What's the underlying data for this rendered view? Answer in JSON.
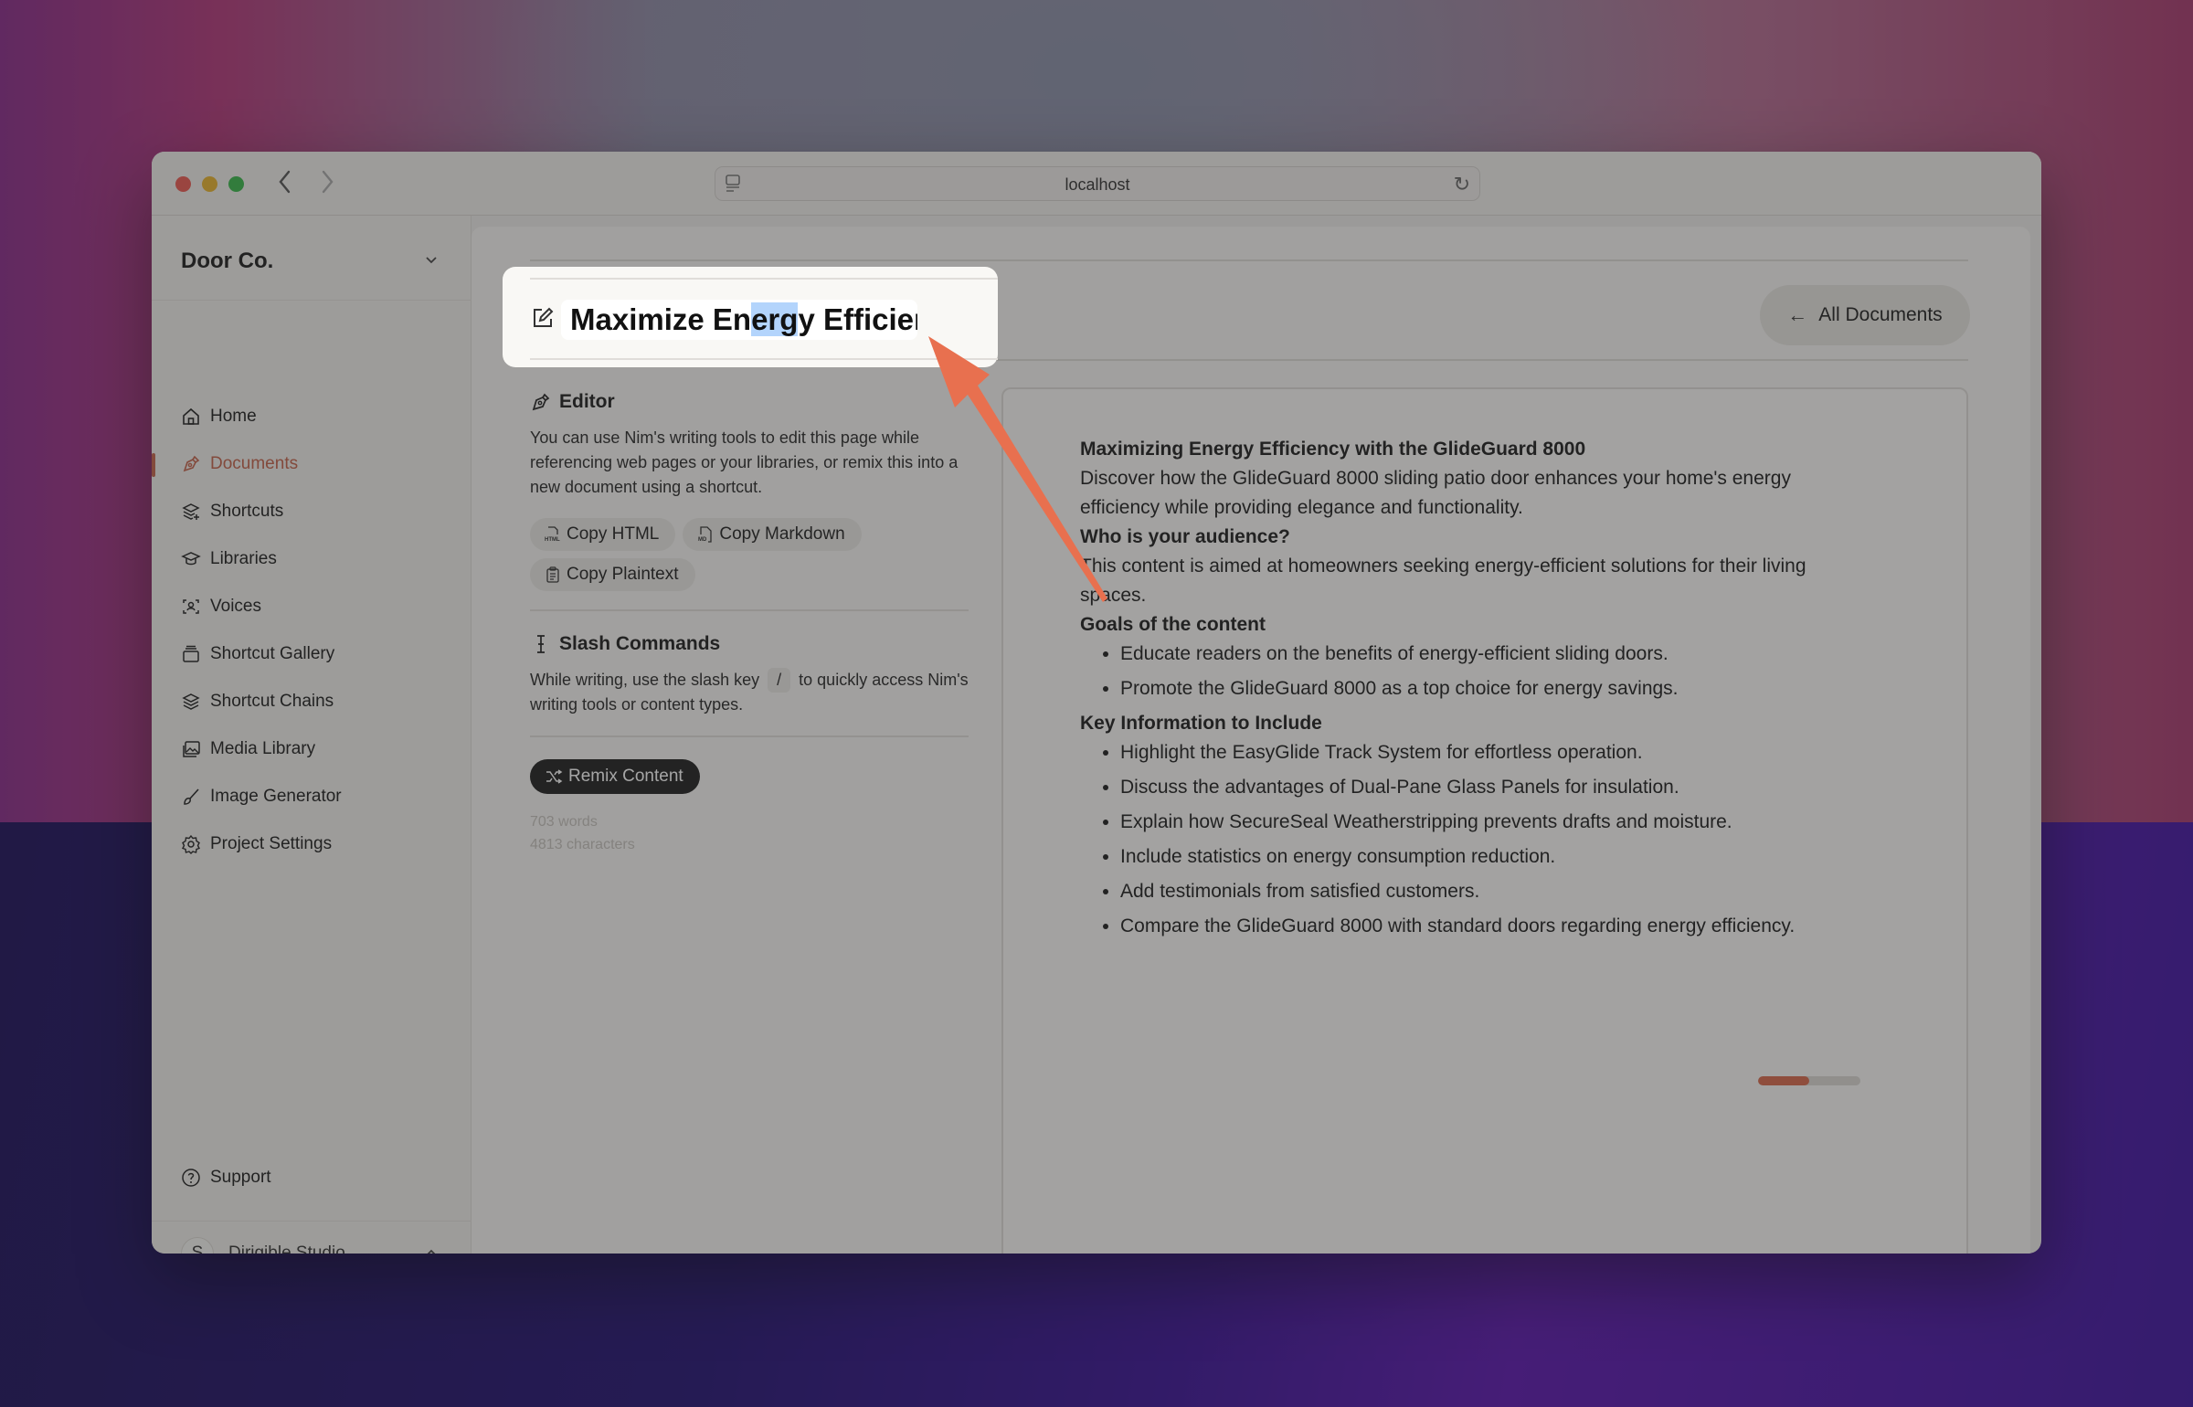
{
  "browser": {
    "url": "localhost",
    "back_icon": "chevron-left-icon",
    "forward_icon": "chevron-right-icon",
    "reload_icon": "reload-icon"
  },
  "sidebar": {
    "org_name": "Door Co.",
    "items": [
      {
        "label": "Home",
        "icon": "home-icon"
      },
      {
        "label": "Documents",
        "icon": "pen-icon",
        "active": true
      },
      {
        "label": "Shortcuts",
        "icon": "layers-plus-icon"
      },
      {
        "label": "Libraries",
        "icon": "graduation-cap-icon"
      },
      {
        "label": "Voices",
        "icon": "voice-scan-icon"
      },
      {
        "label": "Shortcut Gallery",
        "icon": "gallery-icon"
      },
      {
        "label": "Shortcut Chains",
        "icon": "stack-icon"
      },
      {
        "label": "Media Library",
        "icon": "image-icon"
      },
      {
        "label": "Image Generator",
        "icon": "brush-icon"
      },
      {
        "label": "Project Settings",
        "icon": "gear-icon"
      }
    ],
    "support_label": "Support",
    "account": {
      "initial": "S",
      "name": "Dirigible Studio"
    }
  },
  "header": {
    "title_visible": "Maximize Energy Efficienc",
    "title_before_selection": "Maximize En",
    "title_selection": "erg",
    "title_after_selection": "y Efficienc",
    "back_label": "All Documents"
  },
  "editor": {
    "heading": "Editor",
    "description": "You can use Nim's writing tools to edit this page while referencing web pages or your libraries, or remix this into a new document using a shortcut.",
    "copy_buttons": [
      {
        "label": "Copy HTML",
        "icon": "html-file-icon"
      },
      {
        "label": "Copy Markdown",
        "icon": "markdown-file-icon"
      },
      {
        "label": "Copy Plaintext",
        "icon": "clipboard-icon"
      }
    ],
    "slash_heading": "Slash Commands",
    "slash_text_before": "While writing, use the slash key",
    "slash_key": "/",
    "slash_text_after": "to quickly access Nim's writing tools or content types.",
    "remix_label": "Remix Content",
    "word_count": "703 words",
    "char_count": "4813 characters"
  },
  "document": {
    "title": "Maximizing Energy Efficiency with the GlideGuard 8000",
    "intro": "Discover how the GlideGuard 8000 sliding patio door enhances your home's energy efficiency while providing elegance and functionality.",
    "audience_heading": "Who is your audience?",
    "audience_text": "This content is aimed at homeowners seeking energy-efficient solutions for their living spaces.",
    "goals_heading": "Goals of the content",
    "goals": [
      "Educate readers on the benefits of energy-efficient sliding doors.",
      "Promote the GlideGuard 8000 as a top choice for energy savings."
    ],
    "key_heading": "Key Information to Include",
    "key_items": [
      "Highlight the EasyGlide Track System for effortless operation.",
      "Discuss the advantages of Dual-Pane Glass Panels for insulation.",
      "Explain how SecureSeal Weatherstripping prevents drafts and moisture.",
      "Include statistics on energy consumption reduction.",
      "Add testimonials from satisfied customers.",
      "Compare the GlideGuard 8000 with standard doors regarding energy efficiency."
    ]
  },
  "progress": {
    "fraction": 0.5
  },
  "colors": {
    "accent": "#c4624a",
    "callout_arrow": "#e8704f",
    "selection": "#b3d4fc",
    "remix_bg": "#1f1f1f"
  }
}
